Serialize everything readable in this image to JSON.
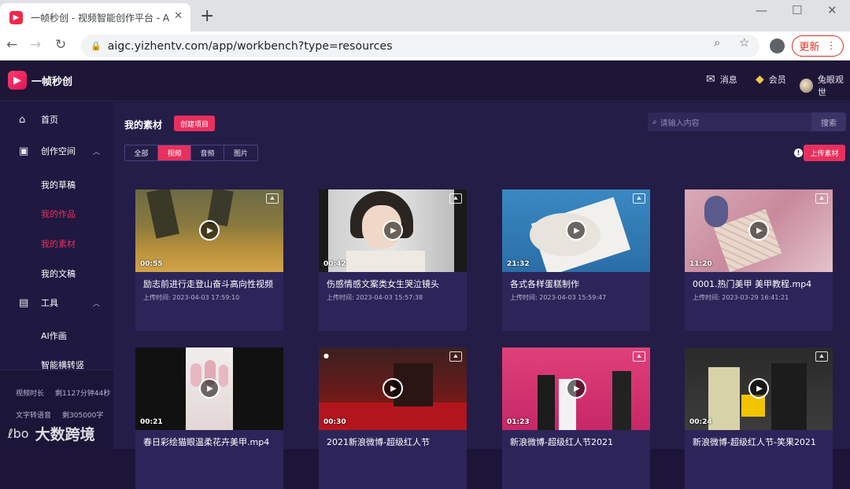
{
  "browser": {
    "tab_title": "一帧秒创 - 视频智能创作平台 - A",
    "url": "aigc.yizhentv.com/app/workbench?type=resources",
    "update_label": "更新"
  },
  "header": {
    "brand": "一帧秒创",
    "message": "消息",
    "member": "会员",
    "user": "兔眼观世"
  },
  "sidebar": {
    "home": "首页",
    "creation_space": "创作空间",
    "drafts": "我的草稿",
    "works": "我的作品",
    "materials": "我的素材",
    "documents": "我的文稿",
    "tools": "工具",
    "ai_paint": "AI作画",
    "smart_cut": "智能横转竖",
    "stats": [
      {
        "label": "视频时长",
        "value": "剩1127分钟44秒"
      },
      {
        "label": "文字转语音",
        "value": "剩305000字"
      }
    ]
  },
  "main": {
    "title": "我的素材",
    "create_label": "创建项目",
    "search_placeholder": "请输入内容",
    "search_label": "搜索",
    "filters": [
      "全部",
      "视频",
      "音频",
      "图片"
    ],
    "upload_label": "上传素材",
    "cards": [
      {
        "title": "励志前进行走登山奋斗高向性视频",
        "time": "上传时间: 2023-04-03 17:59:10",
        "duration": "00:55"
      },
      {
        "title": "伤感情感文案类女生哭泣镜头",
        "time": "上传时间: 2023-04-03 15:57:38",
        "duration": "00:42"
      },
      {
        "title": "各式各样蛋糕制作",
        "time": "上传时间: 2023-04-03 15:59:47",
        "duration": "21:32"
      },
      {
        "title": "0001.热门美甲 美甲教程.mp4",
        "time": "上传时间: 2023-03-29 16:41:21",
        "duration": "11:20"
      },
      {
        "title": "春日彩绘猫眼温柔花卉美甲.mp4",
        "time": "",
        "duration": "00:21"
      },
      {
        "title": "2021新浪微博-超级红人节",
        "time": "",
        "duration": "00:30"
      },
      {
        "title": "新浪微博-超级红人节2021",
        "time": "",
        "duration": "01:23"
      },
      {
        "title": "新浪微博-超级红人节-笑果2021",
        "time": "",
        "duration": "00:24"
      }
    ]
  },
  "watermark": {
    "mark": "ℓbo",
    "text": "大数跨境"
  }
}
